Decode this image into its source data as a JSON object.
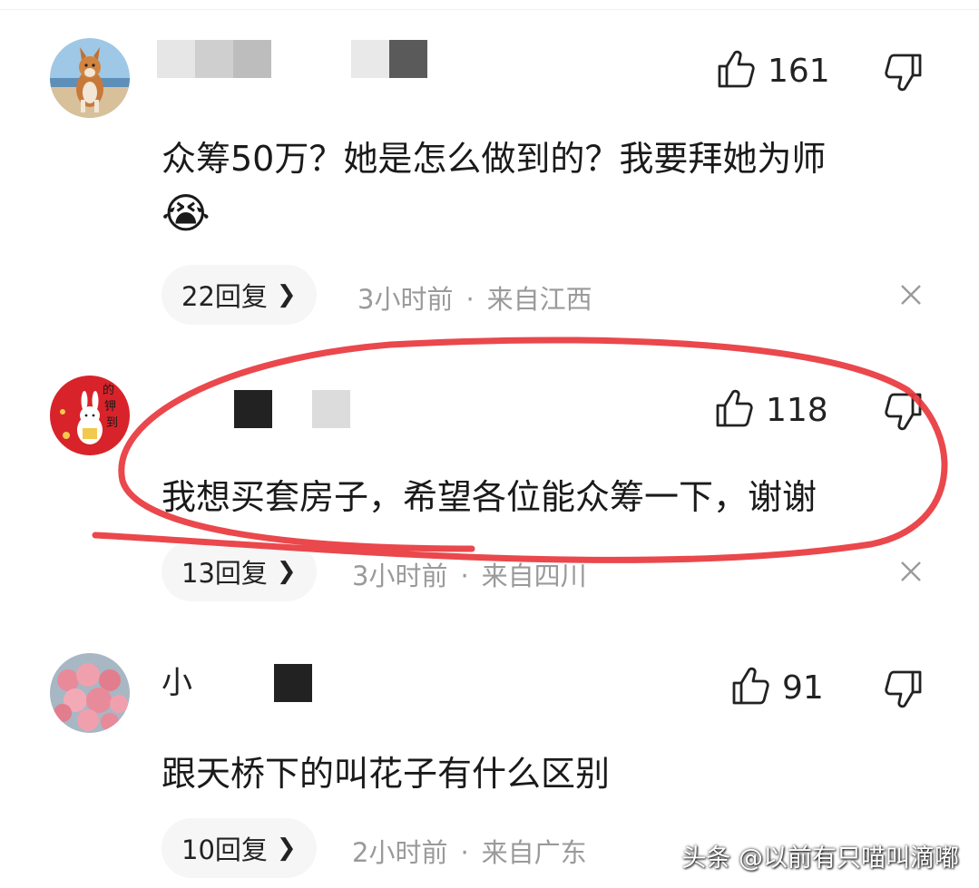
{
  "comments": [
    {
      "likes": "161",
      "text_line1": "众筹50万？她是怎么做到的？我要拜她为师",
      "emoji": "😭",
      "reply_label": "22回复",
      "time": "3小时前",
      "sep": "·",
      "location": "来自江西"
    },
    {
      "likes": "118",
      "text_line1": "我想买套房子，希望各位能众筹一下，谢谢",
      "reply_label": "13回复",
      "time": "3小时前",
      "sep": "·",
      "location": "来自四川"
    },
    {
      "name_visible": "小",
      "likes": "91",
      "text_line1": "跟天桥下的叫花子有什么区别",
      "reply_label": "10回复",
      "time": "2小时前",
      "sep": "·",
      "location": "来自广东"
    }
  ],
  "icons": {
    "like": "thumbs-up-icon",
    "dislike": "thumbs-down-icon",
    "close": "close-icon",
    "chevron": "chevron-right-icon"
  },
  "colors": {
    "annotation_red": "#e8383d",
    "meta_gray": "#9a9a9a",
    "pill_bg": "#f6f6f6"
  },
  "watermark": "头条 @以前有只喵叫滴嘟"
}
